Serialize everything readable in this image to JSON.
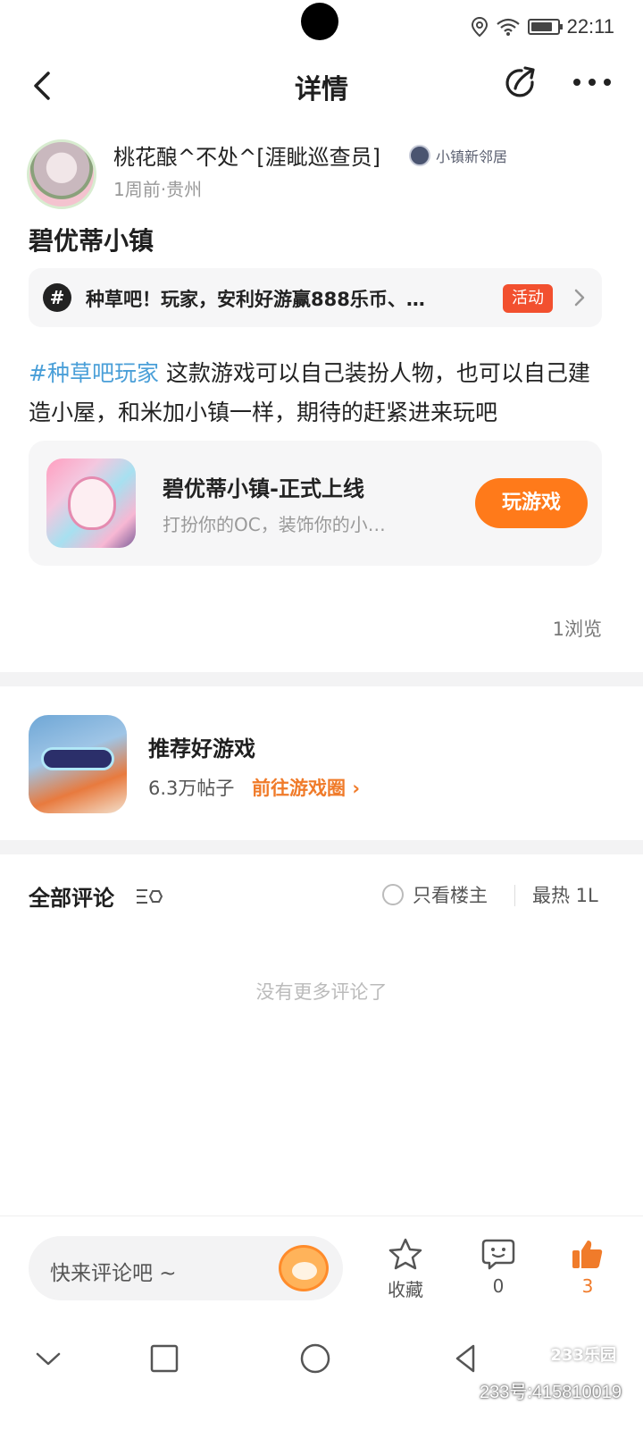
{
  "status": {
    "time": "22:11",
    "battery_level": 0.85
  },
  "header": {
    "title": "详情"
  },
  "author": {
    "name": "桃花酿^不处^[涯眦巡查员]",
    "badge": "小镇新邻居",
    "meta": "1周前·贵州"
  },
  "post": {
    "title": "碧优蒂小镇",
    "topic": {
      "text": "种草吧！玩家，安利好游赢888乐币、…",
      "tag": "活动"
    },
    "hashtag": "#种草吧玩家",
    "body": " 这款游戏可以自己装扮人物，也可以自己建造小屋，和米加小镇一样，期待的赶紧进来玩吧",
    "game": {
      "name": "碧优蒂小镇-正式上线",
      "desc": "打扮你的OC，装饰你的小…",
      "button": "玩游戏"
    },
    "views": "1浏览"
  },
  "recommend": {
    "title": "推荐好游戏",
    "count": "6.3万帖子",
    "link": "前往游戏圈"
  },
  "comments": {
    "title": "全部评论",
    "only_owner": "只看楼主",
    "sort": "最热 1L",
    "empty": "没有更多评论了"
  },
  "bottom": {
    "placeholder": "快来评论吧 ~",
    "favorite": "收藏",
    "comment_count": "0",
    "like_count": "3"
  },
  "watermark": {
    "logo": "233乐园",
    "text": "233号:415810019"
  },
  "colors": {
    "accent": "#ff7a1a",
    "hashtag": "#4a9fd8",
    "tag": "#f2502f"
  }
}
